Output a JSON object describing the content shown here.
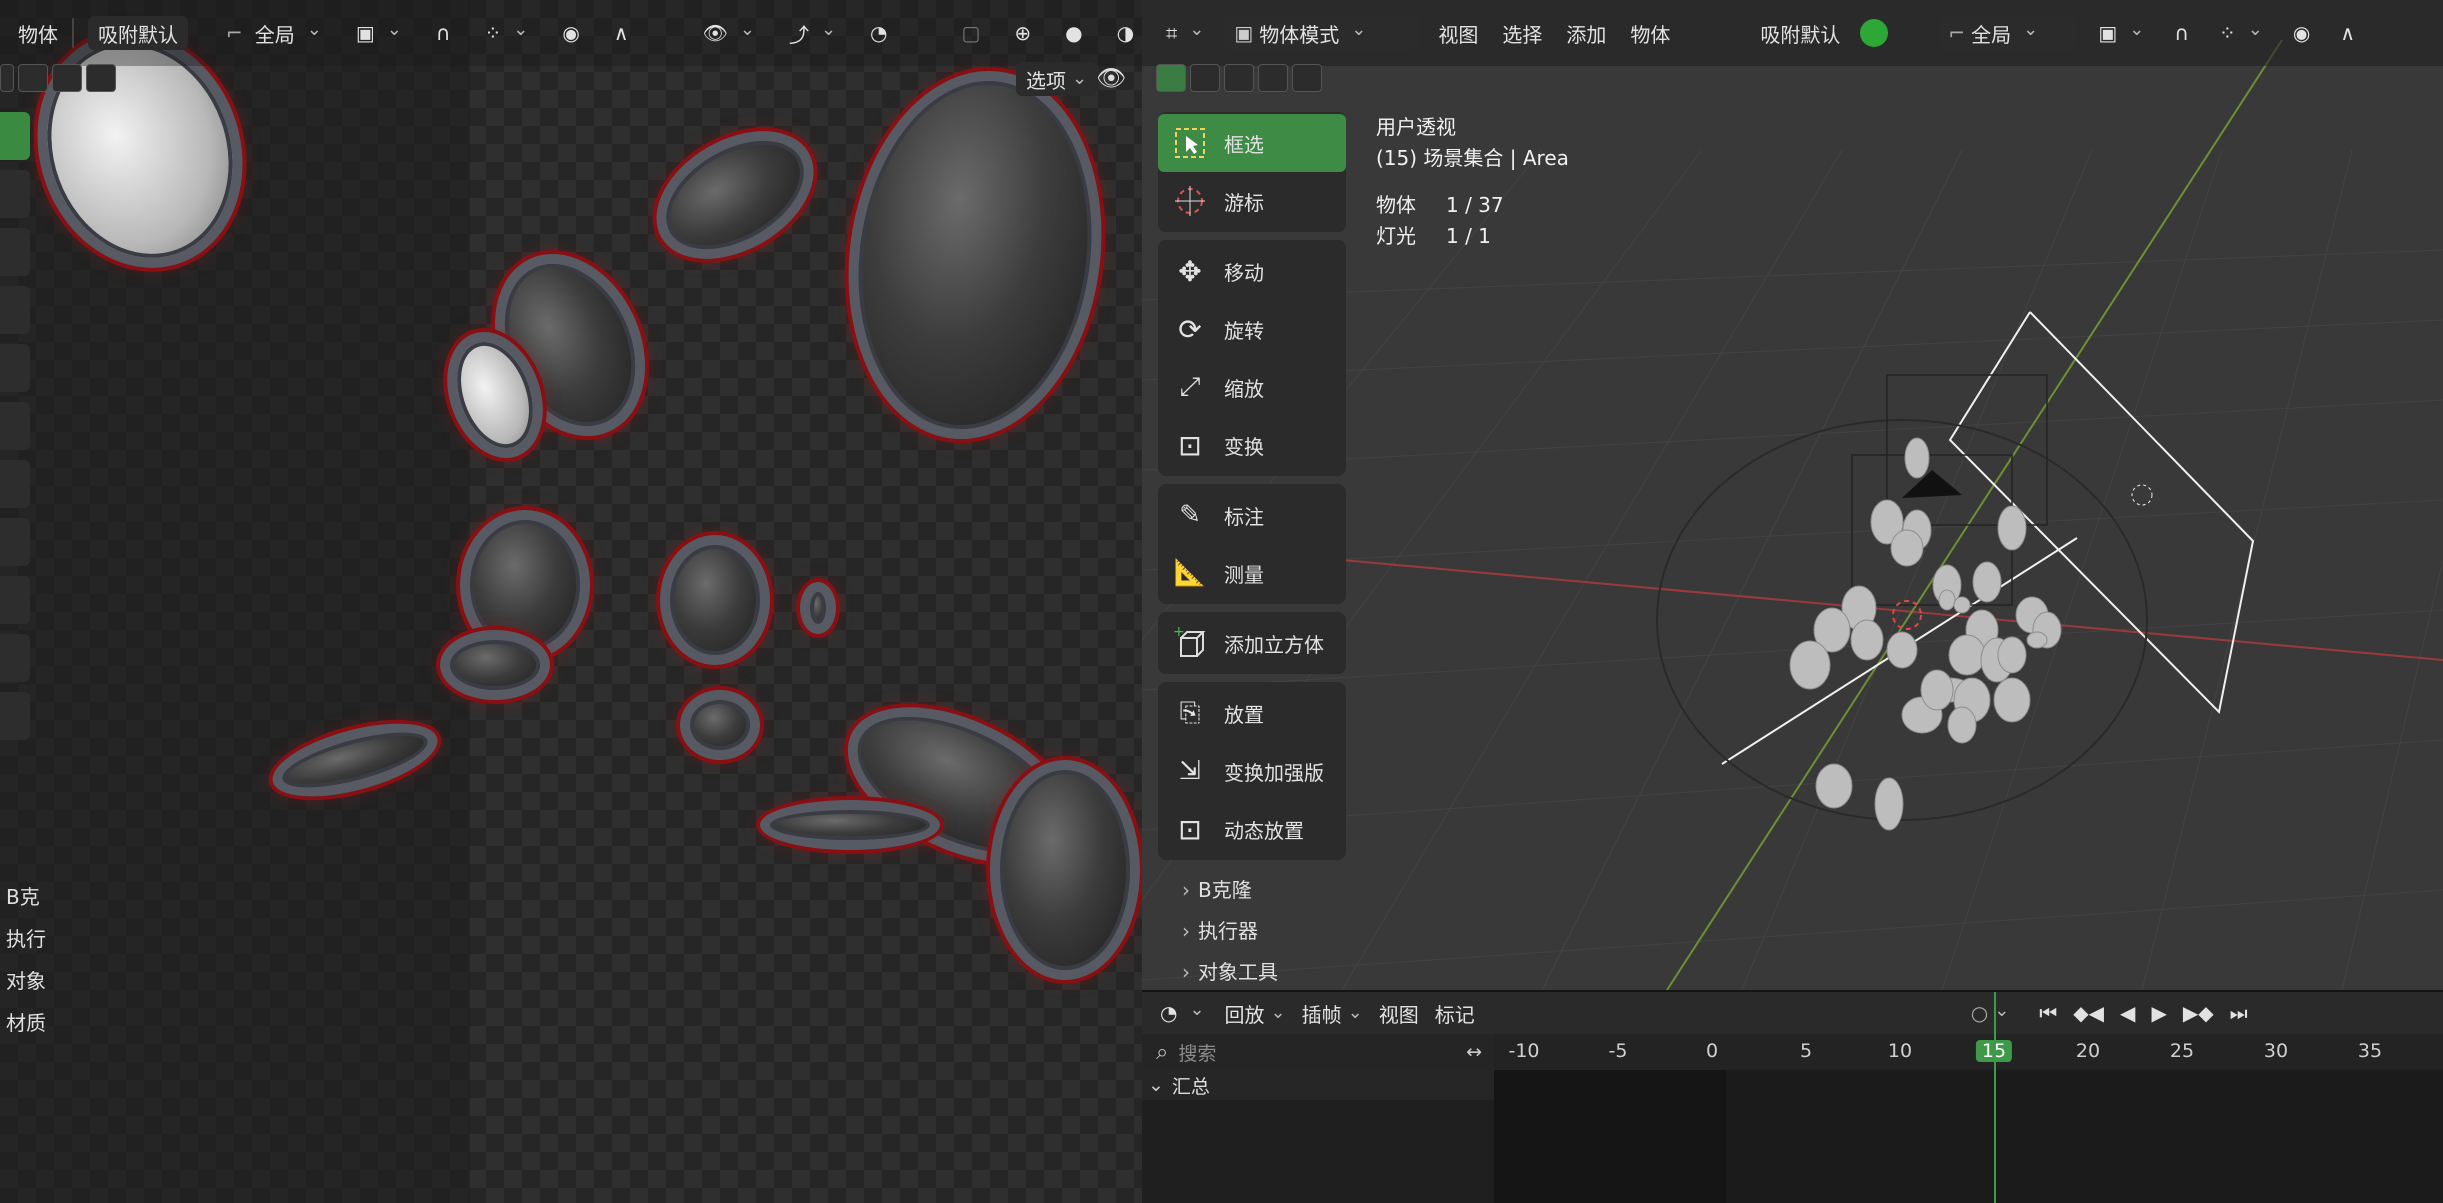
{
  "left_viewport": {
    "header": {
      "object_menu": "物体",
      "snap_label": "吸附默认",
      "transform_space": "全局"
    },
    "options_label": "选项",
    "side_menu": [
      "B克",
      "执行",
      "对象",
      "材质"
    ]
  },
  "right_viewport": {
    "header": {
      "mode": "物体模式",
      "menus": [
        "视图",
        "选择",
        "添加",
        "物体"
      ],
      "snap_label": "吸附默认",
      "transform_space": "全局"
    },
    "info": {
      "view_name": "用户透视",
      "collection": "(15) 场景集合 | Area",
      "stats": [
        {
          "label": "物体",
          "value": "1 / 37"
        },
        {
          "label": "灯光",
          "value": "1 / 1"
        }
      ]
    },
    "tools": [
      {
        "label": "框选",
        "icon": "select-box-icon",
        "active": true
      },
      {
        "label": "游标",
        "icon": "cursor-icon",
        "active": false
      },
      {
        "label": "移动",
        "icon": "move-icon",
        "active": false
      },
      {
        "label": "旋转",
        "icon": "rotate-icon",
        "active": false
      },
      {
        "label": "缩放",
        "icon": "scale-icon",
        "active": false
      },
      {
        "label": "变换",
        "icon": "transform-icon",
        "active": false
      },
      {
        "label": "标注",
        "icon": "annotate-icon",
        "active": false
      },
      {
        "label": "测量",
        "icon": "measure-icon",
        "active": false
      },
      {
        "label": "添加立方体",
        "icon": "add-cube-icon",
        "active": false
      },
      {
        "label": "放置",
        "icon": "place-icon",
        "active": false
      },
      {
        "label": "变换加强版",
        "icon": "transform-plus-icon",
        "active": false
      },
      {
        "label": "动态放置",
        "icon": "dynamic-place-icon",
        "active": false
      }
    ],
    "sub_menus": [
      "B克隆",
      "执行器",
      "对象工具"
    ]
  },
  "timeline": {
    "menus": [
      "回放",
      "插帧",
      "视图",
      "标记"
    ],
    "search_placeholder": "搜索",
    "summary_label": "汇总",
    "ruler_ticks": [
      "-10",
      "-5",
      "0",
      "5",
      "10",
      "15",
      "20",
      "25",
      "30",
      "35"
    ],
    "current_frame": "15"
  },
  "colors": {
    "accent_green": "#3d8b45",
    "x_axis_red": "#b8383b",
    "y_axis_green": "#7fa83a",
    "mirror_red": "#8a0f12"
  }
}
